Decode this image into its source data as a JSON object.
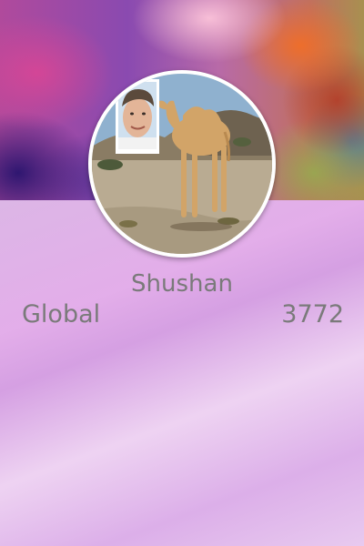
{
  "profile": {
    "name": "Shushan",
    "stat_label": "Global",
    "stat_value": "3772"
  },
  "icons": {
    "avatar": "camel-photo-with-face-inset"
  },
  "colors": {
    "text": "#7a7a7a",
    "avatar_border": "#ffffff",
    "panel": "#dcb6e6"
  }
}
